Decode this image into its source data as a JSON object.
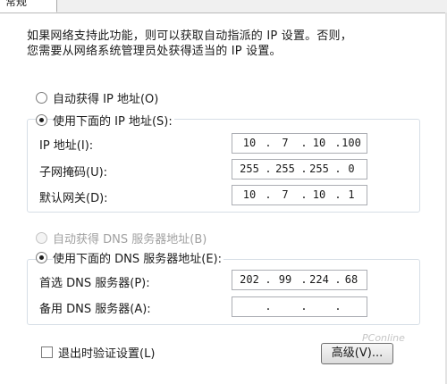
{
  "tab": {
    "label": "常规"
  },
  "description": {
    "line1": "如果网络支持此功能，则可以获取自动指派的 IP 设置。否则，",
    "line2": "您需要从网络系统管理员处获得适当的 IP 设置。"
  },
  "ip": {
    "auto_label": "自动获得 IP 地址(O)",
    "manual_label": "使用下面的 IP 地址(S):",
    "selected": "manual",
    "fields": [
      {
        "label": "IP 地址(I):",
        "octets": [
          "10",
          "7",
          "10",
          "100"
        ]
      },
      {
        "label": "子网掩码(U):",
        "octets": [
          "255",
          "255",
          "255",
          "0"
        ]
      },
      {
        "label": "默认网关(D):",
        "octets": [
          "10",
          "7",
          "10",
          "1"
        ]
      }
    ]
  },
  "dns": {
    "auto_label": "自动获得 DNS 服务器地址(B)",
    "manual_label": "使用下面的 DNS 服务器地址(E):",
    "selected": "manual",
    "auto_disabled": true,
    "fields": [
      {
        "label": "首选 DNS 服务器(P):",
        "octets": [
          "202",
          "99",
          "224",
          "68"
        ]
      },
      {
        "label": "备用 DNS 服务器(A):",
        "octets": [
          "",
          "",
          "",
          ""
        ]
      }
    ]
  },
  "validate": {
    "label": "退出时验证设置(L)",
    "checked": false
  },
  "advanced_button": {
    "label": "高级(V)..."
  },
  "watermark": {
    "text": "PConline"
  }
}
